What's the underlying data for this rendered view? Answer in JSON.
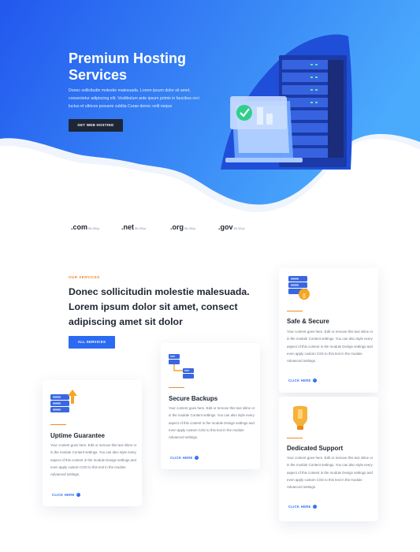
{
  "hero": {
    "title": "Premium Hosting Services",
    "body": "Donec sollicitudin molestie malesuada. Lorem ipsum dolor sit amet, consectetur adipiscing elit. Vestibulum ante ipsum primis in faucibus orci luctus et ultrices posuere cubilia Curae donec velit neque",
    "button_label": "GET WEB HOSTING"
  },
  "domains": [
    {
      "tld": ".com",
      "price": "$6.99/yr"
    },
    {
      "tld": ".net",
      "price": "$6.99/yr"
    },
    {
      "tld": ".org",
      "price": "$6.99/yr"
    },
    {
      "tld": ".gov",
      "price": "$6.99/yr"
    }
  ],
  "services": {
    "label": "OUR SERVICES",
    "heading": "Donec sollicitudin molestie malesuada. Lorem ipsum dolor sit amet, consect adipiscing amet sit dolor",
    "button_label": "ALL SERVICES"
  },
  "cards": [
    {
      "icon": "server-upload-icon",
      "title": "Uptime Guarantee",
      "body": "Your content goes here. Edit or remove this text inline or in the module Content settings. You can also style every aspect of this content in the module Design settings and even apply custom CSS to this text in the module Advanced settings.",
      "link": "CLICK HERE"
    },
    {
      "icon": "server-backup-icon",
      "title": "Secure Backups",
      "body": "Your content goes here. Edit or remove this text inline or in the module Content settings. You can also style every aspect of this content in the module Design settings and even apply custom CSS to this text in the module Advanced settings.",
      "link": "CLICK HERE"
    },
    {
      "icon": "server-lock-icon",
      "title": "Safe & Secure",
      "body": "Your content goes here. Edit or remove this text inline or in the module Content settings. You can also style every aspect of this content in the module Design settings and even apply custom CSS to this text in the module Advanced settings.",
      "link": "CLICK HERE"
    },
    {
      "icon": "lightbulb-icon",
      "title": "Dedicated Support",
      "body": "Your content goes here. Edit or remove this text inline or in the module Content settings. You can also style every aspect of this content in the module Design settings and even apply custom CSS to this text in the module Advanced settings.",
      "link": "CLICK HERE"
    }
  ],
  "colors": {
    "hero_gradient_start": "#2563f0",
    "hero_gradient_end": "#48a9fb",
    "accent_orange": "#f08a24",
    "button_dark": "#1e2636",
    "button_blue": "#2b6af2"
  }
}
